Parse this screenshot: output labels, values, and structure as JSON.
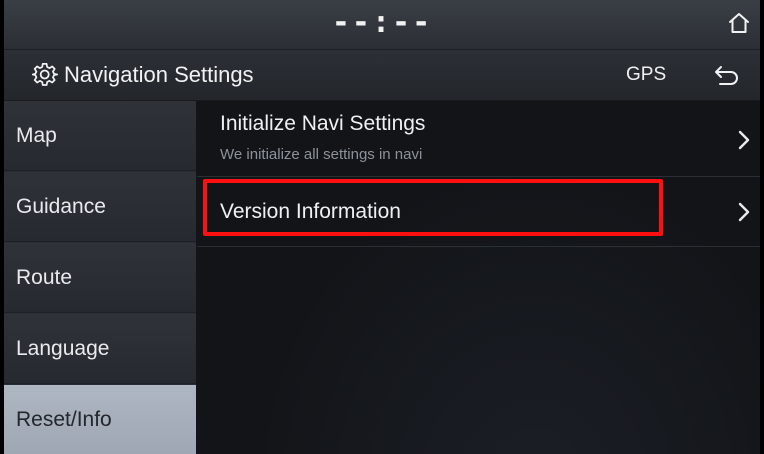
{
  "status_bar": {
    "clock": "--:--",
    "home_icon": "home-icon"
  },
  "header": {
    "settings_icon": "gear-icon",
    "title": "Navigation Settings",
    "gps_label": "GPS",
    "back_icon": "back-arrow-icon"
  },
  "sidebar": {
    "items": [
      {
        "label": "Map",
        "active": false
      },
      {
        "label": "Guidance",
        "active": false
      },
      {
        "label": "Route",
        "active": false
      },
      {
        "label": "Language",
        "active": false
      },
      {
        "label": "Reset/Info",
        "active": true
      }
    ]
  },
  "content": {
    "rows": [
      {
        "title": "Initialize Navi Settings",
        "subtitle": "We initialize all settings in navi",
        "icon": "chevron-right-icon"
      },
      {
        "title": "Version Information",
        "icon": "chevron-right-icon",
        "highlighted": true
      }
    ]
  },
  "colors": {
    "active_tab_bg": "#aeb6c2",
    "highlight_border": "#ff1010",
    "background": "#121418"
  }
}
